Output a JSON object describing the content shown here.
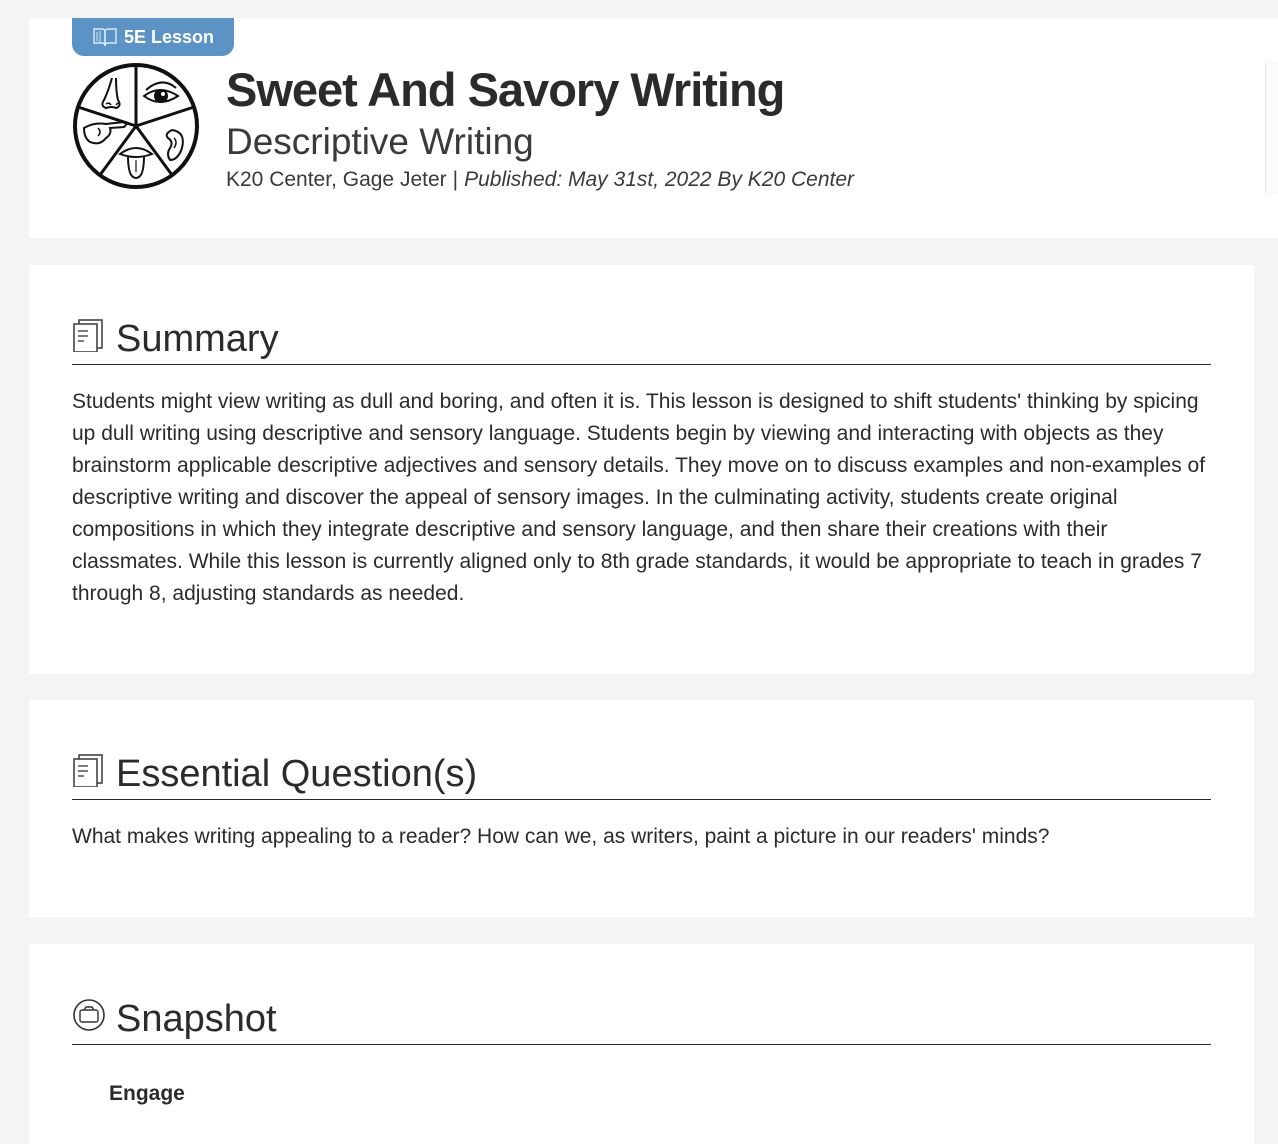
{
  "header": {
    "tag_label": "5E Lesson",
    "tag_icon": "book-icon",
    "tag_color": "#5a93c4",
    "logo_icon": "five-senses-icon",
    "title": "Sweet And Savory Writing",
    "subtitle": "Descriptive Writing",
    "authors": "K20 Center, Gage Jeter",
    "separator": "|",
    "published": "Published: May 31st, 2022 By K20 Center"
  },
  "sections": {
    "summary": {
      "icon": "document-icon",
      "heading": "Summary",
      "text": "Students might view writing as dull and boring, and often it is. This lesson is designed to shift students' thinking by spicing up dull writing using descriptive and sensory language. Students begin by viewing and interacting with objects as they brainstorm applicable descriptive adjectives and sensory details. They move on to discuss examples and non-examples of descriptive writing and discover the appeal of sensory images. In the culminating activity, students create original compositions in which they integrate descriptive and sensory language, and then share their creations with their classmates. While this lesson is currently aligned only to 8th grade standards, it would be appropriate to teach in grades 7 through 8, adjusting standards as needed."
    },
    "essential": {
      "icon": "document-icon",
      "heading": "Essential Question(s)",
      "text": "What makes writing appealing to a reader? How can we, as writers, paint a picture in our readers' minds?"
    },
    "snapshot": {
      "icon": "camera-icon",
      "heading": "Snapshot",
      "first_phase": "Engage"
    }
  }
}
